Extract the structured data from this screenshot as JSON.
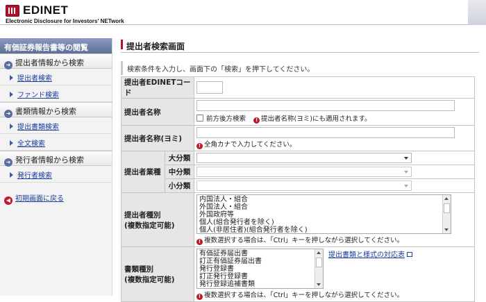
{
  "header": {
    "logo": "EDINET",
    "subtitle": "Electronic Disclosure for Investors' NETwork"
  },
  "sidebar": {
    "title": "有価証券報告書等の閲覧",
    "sections": [
      {
        "label": "提出者情報から検索",
        "items": [
          "提出者検索",
          "ファンド検索"
        ]
      },
      {
        "label": "書類情報から検索",
        "items": [
          "提出書類検索",
          "全文検索"
        ]
      },
      {
        "label": "発行者情報から検索",
        "items": [
          "発行者検索"
        ]
      }
    ],
    "back_link": "初期画面に戻る"
  },
  "main": {
    "title": "提出者検索画面",
    "instruction": "検索条件を入力し、画面下の「検索」を押下してください。",
    "fields": {
      "edinet_code_label": "提出者EDINETコード",
      "edinet_code_value": "",
      "name_label": "提出者名称",
      "name_value": "",
      "name_option": "前方後方検索",
      "name_note": "提出者名称(ヨミ)にも適用されます。",
      "kana_label": "提出者名称(ヨミ)",
      "kana_value": "",
      "kana_note": "全角カナで入力してください。",
      "industry_label": "提出者業種",
      "industry_large": "大分類",
      "industry_medium": "中分類",
      "industry_small": "小分類",
      "type_label_1": "提出者種別",
      "type_label_2": "(複数指定可能)",
      "type_options": [
        "内国法人・組合",
        "外国法人・組合",
        "外国政府等",
        "個人(組合発行者を除く)",
        "個人(非居住者)(組合発行者を除く)"
      ],
      "type_note": "複数選択する場合は、「Ctrl」キーを押しながら選択してください。",
      "doc_label_1": "書類種別",
      "doc_label_2": "(複数指定可能)",
      "doc_options": [
        "有価証券届出書",
        "訂正有価証券届出書",
        "発行登録書",
        "訂正発行登録書",
        "発行登録追補書類"
      ],
      "doc_link": "提出書類と様式の対応表",
      "doc_note": "複数選択する場合は、「Ctrl」キーを押しながら選択してください。"
    }
  },
  "colors": {
    "accent": "#b0112a",
    "sidebar_head": "#6a7aa4",
    "link": "#1a3d9a"
  }
}
